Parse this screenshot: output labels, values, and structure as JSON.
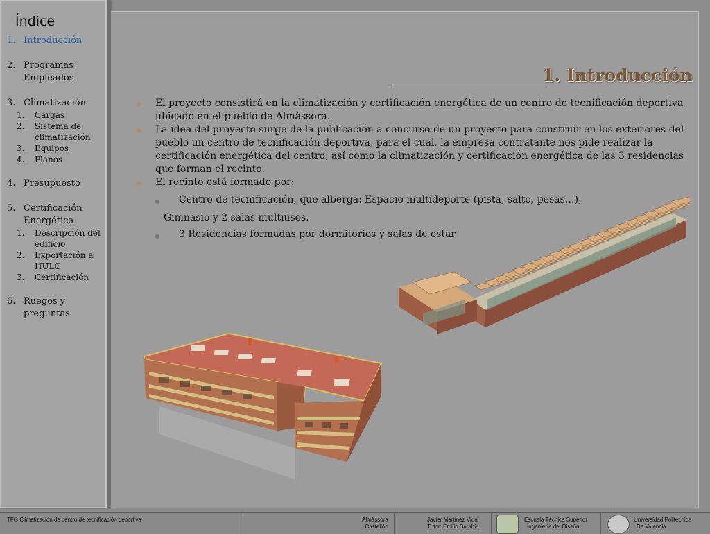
{
  "sidebar": {
    "title": "Índice",
    "items": [
      {
        "num": "1.",
        "label": "Introducción",
        "active": true,
        "subs": []
      },
      {
        "num": "2.",
        "label": "Programas Empleados",
        "subs": []
      },
      {
        "num": "3.",
        "label": "Climatización",
        "subs": [
          {
            "num": "1.",
            "label": "Cargas"
          },
          {
            "num": "2.",
            "label": "Sistema de climatización"
          },
          {
            "num": "3.",
            "label": "Equipos"
          },
          {
            "num": "4.",
            "label": "Planos"
          }
        ]
      },
      {
        "num": "4.",
        "label": "Presupuesto",
        "subs": []
      },
      {
        "num": "5.",
        "label": "Certificación Energética",
        "subs": [
          {
            "num": "1.",
            "label": "Descripción del edificio"
          },
          {
            "num": "2.",
            "label": "Exportación a HULC"
          },
          {
            "num": "3.",
            "label": "Certificación"
          }
        ]
      },
      {
        "num": "6.",
        "label": "Ruegos y preguntas",
        "subs": []
      }
    ]
  },
  "slide": {
    "title": "1. Introducción",
    "bullets": [
      "El proyecto consistirá en la climatización y certificación energética de un centro de tecnificación deportiva ubicado en el pueblo de Almàssora.",
      "La idea del proyecto surge de la publicación a concurso de un proyecto para construir en los exteriores del pueblo un centro de tecnificación deportiva, para el cual, la empresa contratante nos pide realizar la certificación energética del centro, así como la climatización  y certificación  energética de las 3 residencias que forman el recinto.",
      "El recinto está formado por:"
    ],
    "sub1": "Centro de tecnificación, que alberga: Espacio multideporte (pista, salto, pesas…),",
    "sub1_cont": "Gimnasio y 2 salas multiusos.",
    "sub2": "3 Residencias formadas por dormitorios y salas de estar"
  },
  "footer": {
    "project": "TFG Climatización de centro de tecnificación deportiva",
    "place1": "Almàssora",
    "place2": "Castellón",
    "author": "Javier Martínez Vidal",
    "tutor": "Tutor: Emilio Sarabia",
    "school1": "Escuela Técnica Superior",
    "school2": "Ingeniería del Diseño",
    "univ1": "Universidad Politécnica",
    "univ2": "De Valencia"
  },
  "colors": {
    "title": "#7a5a3a",
    "active_item": "#1f5fa8",
    "roof": "#c56a5a",
    "wall": "#b0704f"
  }
}
